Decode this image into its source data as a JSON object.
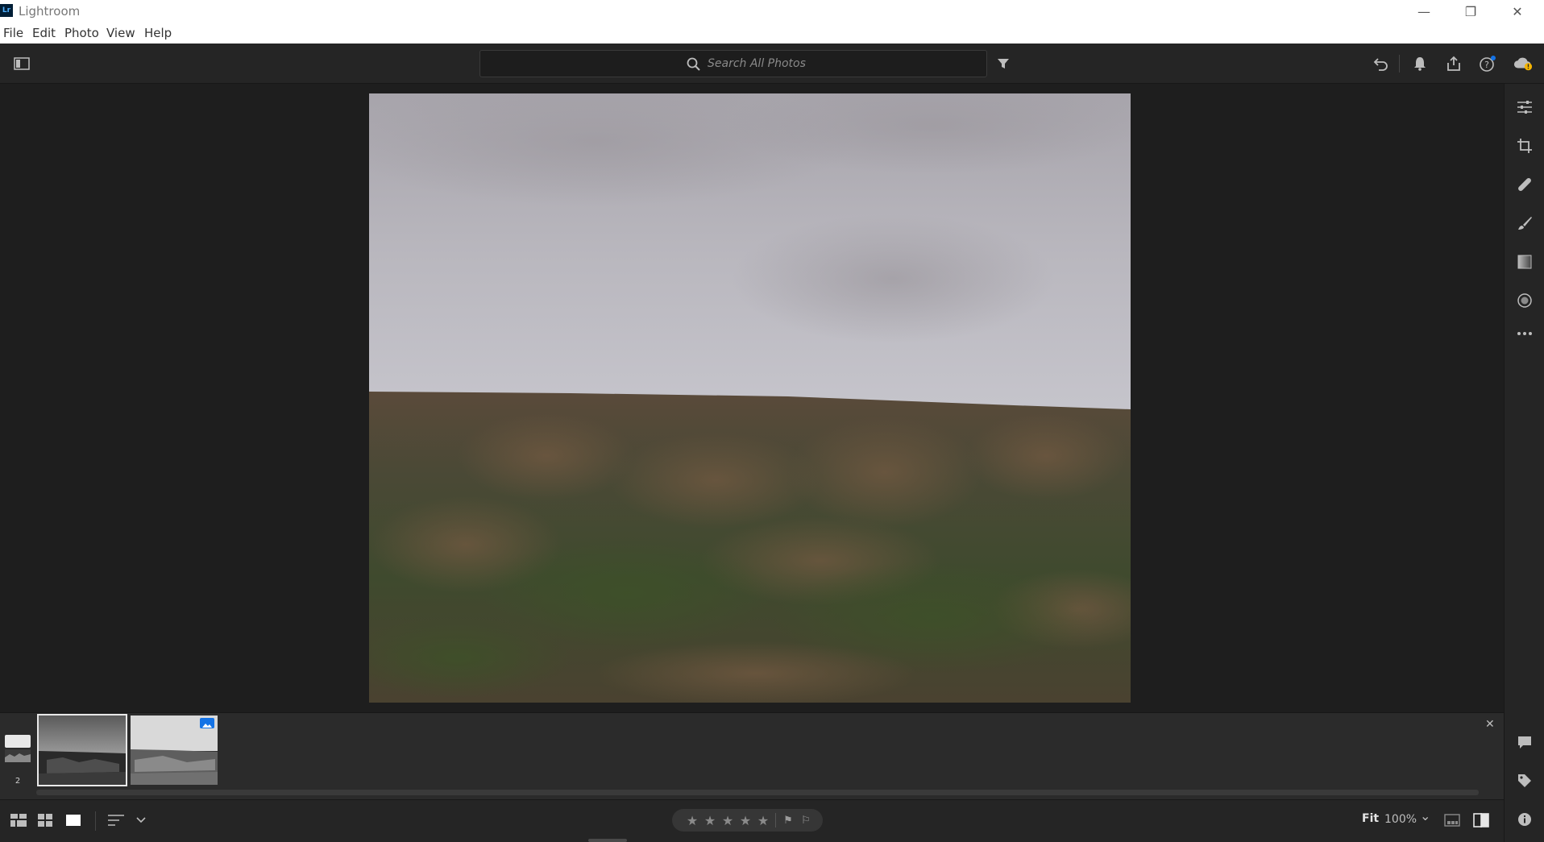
{
  "window": {
    "title": "Lightroom",
    "logo_text": "Lr",
    "minimize_glyph": "—",
    "maximize_glyph": "❐",
    "close_glyph": "✕"
  },
  "menu": {
    "items": [
      {
        "label": "File"
      },
      {
        "label": "Edit"
      },
      {
        "label": "Photo"
      },
      {
        "label": "View"
      },
      {
        "label": "Help"
      }
    ]
  },
  "toolbar": {
    "search_placeholder": "Search All Photos",
    "icons": [
      "panel-toggle-icon",
      "filter-icon",
      "undo-icon",
      "bell-icon",
      "share-icon",
      "help-icon",
      "cloud-sync-icon"
    ]
  },
  "filmstrip": {
    "stack_count": "2",
    "close_glyph": "✕",
    "thumbnails": [
      {
        "name": "thumb-1",
        "selected": true,
        "badge": false
      },
      {
        "name": "thumb-2",
        "selected": false,
        "badge": true
      }
    ]
  },
  "right_rail": {
    "tools": [
      "edit-sliders-icon",
      "crop-icon",
      "healing-icon",
      "brush-icon",
      "linear-gradient-icon",
      "radial-gradient-icon",
      "more-icon"
    ],
    "bottom": [
      "comment-icon",
      "tag-icon",
      "info-icon"
    ]
  },
  "bottombar": {
    "stars": [
      "★",
      "★",
      "★",
      "★",
      "★"
    ],
    "flags": [
      "⚑",
      "⚐"
    ],
    "zoom_fit": "Fit",
    "zoom_pct": "100%",
    "zoom_chevron": "⌄"
  },
  "colors": {
    "accent": "#1473e6",
    "panel": "#252525",
    "canvas": "#1e1e1e",
    "warning": "#f5b400"
  }
}
